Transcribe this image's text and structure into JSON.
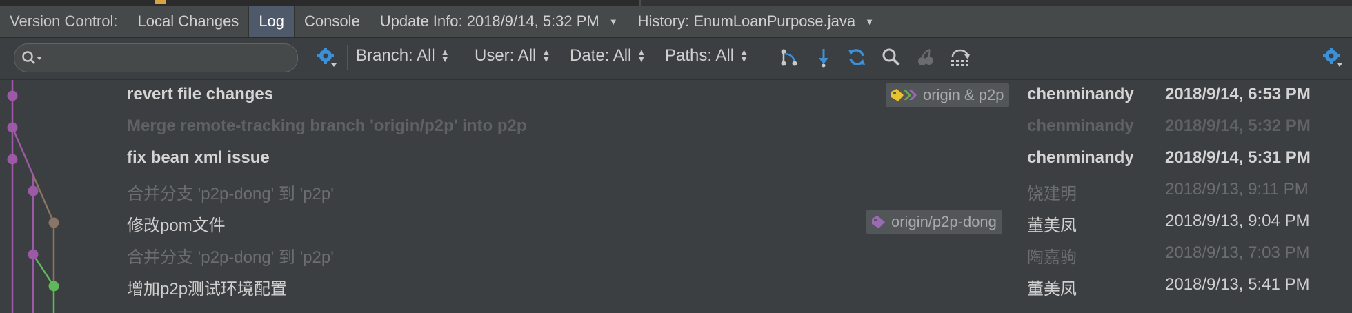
{
  "tabs": {
    "label": "Version Control:",
    "items": [
      {
        "label": "Local Changes"
      },
      {
        "label": "Log"
      },
      {
        "label": "Console"
      },
      {
        "label": "Update Info: 2018/9/14, 5:32 PM"
      },
      {
        "label": "History: EnumLoanPurpose.java"
      }
    ]
  },
  "toolbar": {
    "search_value": "",
    "filters": [
      {
        "label": "Branch: All"
      },
      {
        "label": "User: All"
      },
      {
        "label": "Date: All"
      },
      {
        "label": "Paths: All"
      }
    ],
    "icons": [
      "settings-icon",
      "branch-icon",
      "arrow-down-icon",
      "refresh-icon",
      "find-icon",
      "cherry-pick-icon",
      "intellisort-icon",
      "settings-icon"
    ]
  },
  "commits": [
    {
      "message": "revert file changes",
      "ref": "origin & p2p",
      "author": "chenminandy",
      "date": "2018/9/14, 6:53 PM"
    },
    {
      "message": "Merge remote-tracking branch 'origin/p2p' into p2p",
      "ref": "",
      "author": "chenminandy",
      "date": "2018/9/14, 5:32 PM"
    },
    {
      "message": "fix bean xml issue",
      "ref": "",
      "author": "chenminandy",
      "date": "2018/9/14, 5:31 PM"
    },
    {
      "message": "合并分支 'p2p-dong' 到 'p2p'",
      "ref": "",
      "author": "饶建明",
      "date": "2018/9/13, 9:11 PM"
    },
    {
      "message": "修改pom文件",
      "ref": "origin/p2p-dong",
      "author": "董美凤",
      "date": "2018/9/13, 9:04 PM"
    },
    {
      "message": "合并分支 'p2p-dong' 到 'p2p'",
      "ref": "",
      "author": "陶嘉驹",
      "date": "2018/9/13, 7:03 PM"
    },
    {
      "message": "增加p2p测试环境配置",
      "ref": "",
      "author": "董美凤",
      "date": "2018/9/13, 5:41 PM"
    }
  ],
  "colors": {
    "purple": "#9b59a6",
    "brown": "#8a7466",
    "green": "#5fb85a",
    "tag_yellow": "#e8c330",
    "tag_green": "#6aa84f",
    "tag_purple": "#9b6ab5"
  }
}
